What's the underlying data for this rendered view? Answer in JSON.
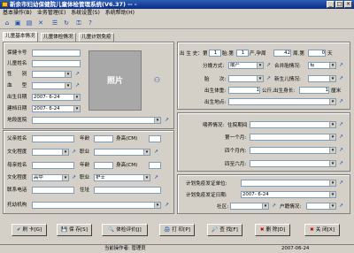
{
  "window": {
    "title": "新余市妇幼保健院儿童体检管理系统(V6.37) -- -"
  },
  "menu": [
    "基本操作(B)",
    "业务管理(E)",
    "系统设置(S)",
    "系统帮助(H)"
  ],
  "toolbar_icons": [
    "home-icon",
    "save-icon",
    "print-icon",
    "delete-icon",
    "list-icon",
    "refresh-icon",
    "key-icon",
    "help-icon"
  ],
  "tabs": [
    "儿童基本情况",
    "儿童体检情况",
    "儿童计划免疫"
  ],
  "basic": {
    "labels": {
      "health_no": "保健卡号",
      "child_name": "儿童姓名",
      "sex": "性　　别",
      "blood": "血　　型",
      "birth_date": "出生日期",
      "create_date": "建档日期",
      "address": "地段医院"
    },
    "values": {
      "birth_date": "2007- 6-24",
      "create_date": "2007- 6-24"
    },
    "photo_label": "照片"
  },
  "birth": {
    "birth_history": {
      "label": "出 生 史：",
      "parity_pre": "第",
      "parity": "1",
      "parity_suf": "胎,第",
      "delivery": "1",
      "delivery_suf": "产,孕周",
      "weeks": "42",
      "weeks_suf": "周,第",
      "days": "0",
      "days_suf": "天"
    },
    "delivery_method": {
      "label": "分娩方式:",
      "value": "顺产"
    },
    "combined": {
      "label": "合并胎情况:",
      "value": "有"
    },
    "fetus": {
      "label": "胎　　次:"
    },
    "newborn": {
      "label": "新生儿情况:"
    },
    "weight": {
      "label": "出生体重:",
      "value": "1",
      "unit": "公斤,出生身长:",
      "height": "1",
      "height_unit": "厘米"
    },
    "place": {
      "label": "出生地点:"
    }
  },
  "feeding": {
    "label": "喂养情况:",
    "by": "住院期间",
    "m1": "第一个月:",
    "m4": "四个月内:",
    "m6": "四至六月:"
  },
  "parents": {
    "father": {
      "label": "父亲姓名",
      "age": "年龄",
      "height": "身高(CM)"
    },
    "edu1": {
      "label": "文化程度",
      "job": "职业"
    },
    "mother": {
      "label": "母亲姓名",
      "age": "年龄",
      "height": "身高(CM)"
    },
    "edu2": {
      "label": "文化程度",
      "value": "高中",
      "job": "职业",
      "job_value": "护士"
    },
    "phone": {
      "label": "联系电话",
      "addr": "住址"
    },
    "nursery": {
      "label": "托幼机构"
    }
  },
  "immunization": {
    "cert_unit": {
      "label": "计划免疫发证单位:"
    },
    "cert_date": {
      "label": "计划免疫发证日期:",
      "value": "2007- 6-24"
    },
    "community": {
      "label": "社区:",
      "household": "户籍情况:"
    }
  },
  "buttons": [
    {
      "label": "刷 卡[G]",
      "icon": "✔"
    },
    {
      "label": "保 存[S]",
      "icon": "💾"
    },
    {
      "label": "体检评价[J]",
      "icon": "🔍"
    },
    {
      "label": "打 印[P]",
      "icon": "🖨"
    },
    {
      "label": "查 找[F]",
      "icon": "🔎"
    },
    {
      "label": "删 除[D]",
      "icon": "✖"
    },
    {
      "label": "关 闭[X]",
      "icon": "✖"
    }
  ],
  "status": {
    "operator": "当前操作者: 管理员",
    "date": "2007-06-24"
  }
}
